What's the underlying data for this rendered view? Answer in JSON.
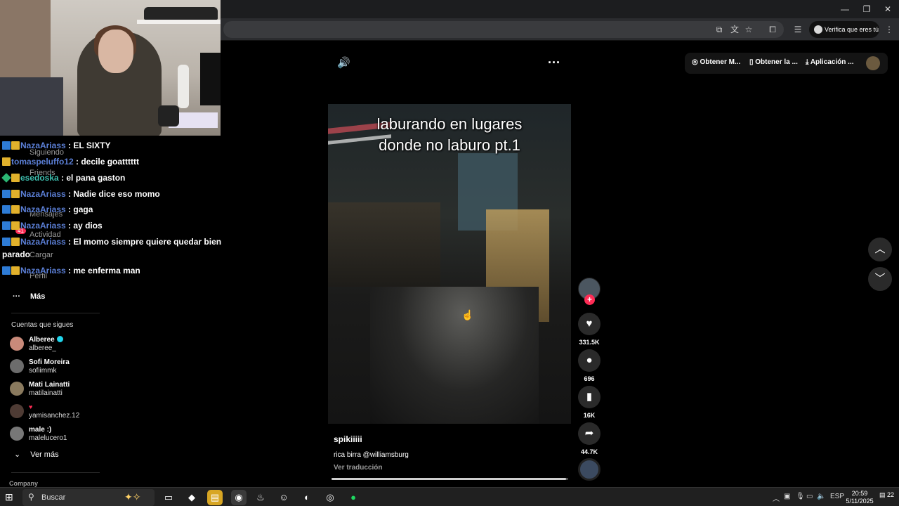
{
  "browser": {
    "verify_label": "Verifica que eres tú"
  },
  "chat": [
    {
      "user": "NazaAriass",
      "message": " : EL SIXTY"
    },
    {
      "user": "tomaspeluffo12",
      "message": " : decile goatttttt"
    },
    {
      "user": "esedoska",
      "message": " : el pana gaston"
    },
    {
      "user": "NazaAriass",
      "message": " : Nadie dice eso momo"
    },
    {
      "user": "NazaAriass",
      "message": " : gaga"
    },
    {
      "user": "NazaAriass",
      "message": " : ay dios"
    },
    {
      "user": "NazaAriass",
      "message": " : El momo siempre quiere quedar bien"
    },
    {
      "continuation": "parado"
    },
    {
      "user": "NazaAriass",
      "message": " : me enferma man"
    }
  ],
  "sidebar": {
    "ghost_items": [
      "Siguiendo",
      "Friends",
      "Mensajes",
      "Actividad",
      "Cargar",
      "Perfil"
    ],
    "activity_badge": "41",
    "more_label": "Más",
    "follows_title": "Cuentas que sigues",
    "follows": [
      {
        "name": "Alberee",
        "handle": "alberee_",
        "verified": true
      },
      {
        "name": "Sofi Moreira",
        "handle": "sofiimmk"
      },
      {
        "name": "Mati Lainatti",
        "handle": "matilainatti"
      },
      {
        "name": "",
        "handle": "yamisanchez.12",
        "heart": true
      },
      {
        "name": "male :)",
        "handle": "malelucero1"
      }
    ],
    "see_more_label": "Ver más",
    "company_label": "Company"
  },
  "top_actions": {
    "coins_label": "Obtener M...",
    "app_label": "Obtener la ...",
    "download_label": "Aplicación ..."
  },
  "video": {
    "caption_line1": "laburando en lugares",
    "caption_line2": "donde no laburo  pt.1",
    "author": "spikiiiii",
    "description": "rica birra @williamsburg",
    "translate_label": "Ver traducción",
    "progress": 0.99
  },
  "rail": {
    "likes": "331.5K",
    "comments": "696",
    "saves": "16K",
    "shares": "44.7K"
  },
  "taskbar": {
    "search_placeholder": "Buscar",
    "lang": "ESP",
    "time": "20:59",
    "date": "5/11/2025",
    "notifications": "22"
  },
  "colors": {
    "accent_pink": "#fe2c55",
    "verified_cyan": "#20d5ec",
    "chat_user": "#5b7fd6"
  }
}
